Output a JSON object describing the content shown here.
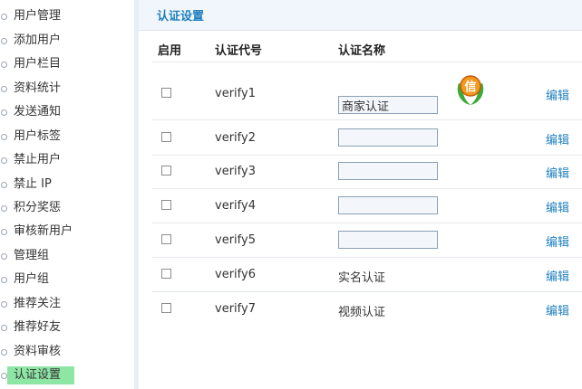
{
  "sidebar": {
    "items": [
      {
        "label": "用户管理"
      },
      {
        "label": "添加用户"
      },
      {
        "label": "用户栏目"
      },
      {
        "label": "资料统计"
      },
      {
        "label": "发送通知"
      },
      {
        "label": "用户标签"
      },
      {
        "label": "禁止用户"
      },
      {
        "label": "禁止 IP"
      },
      {
        "label": "积分奖惩"
      },
      {
        "label": "审核新用户"
      },
      {
        "label": "管理组"
      },
      {
        "label": "用户组"
      },
      {
        "label": "推荐关注"
      },
      {
        "label": "推荐好友"
      },
      {
        "label": "资料审核"
      },
      {
        "label": "认证设置",
        "active": true
      }
    ]
  },
  "main": {
    "title": "认证设置",
    "headers": {
      "enabled": "启用",
      "code": "认证代号",
      "name": "认证名称"
    },
    "rows": [
      {
        "code": "verify1",
        "name": "商家认证",
        "editable": true,
        "has_icon": true,
        "action": "编辑"
      },
      {
        "code": "verify2",
        "name": "",
        "editable": true,
        "action": "编辑"
      },
      {
        "code": "verify3",
        "name": "",
        "editable": true,
        "action": "编辑"
      },
      {
        "code": "verify4",
        "name": "",
        "editable": true,
        "action": "编辑"
      },
      {
        "code": "verify5",
        "name": "",
        "editable": true,
        "action": "编辑"
      },
      {
        "code": "verify6",
        "name": "实名认证",
        "editable": false,
        "action": "编辑"
      },
      {
        "code": "verify7",
        "name": "视频认证",
        "editable": false,
        "action": "编辑"
      }
    ],
    "badge_icon_text": "信",
    "colors": {
      "accent": "#1f7fbf",
      "active_highlight": "#8ee6a4",
      "title_bg": "#f0f6fb"
    }
  }
}
